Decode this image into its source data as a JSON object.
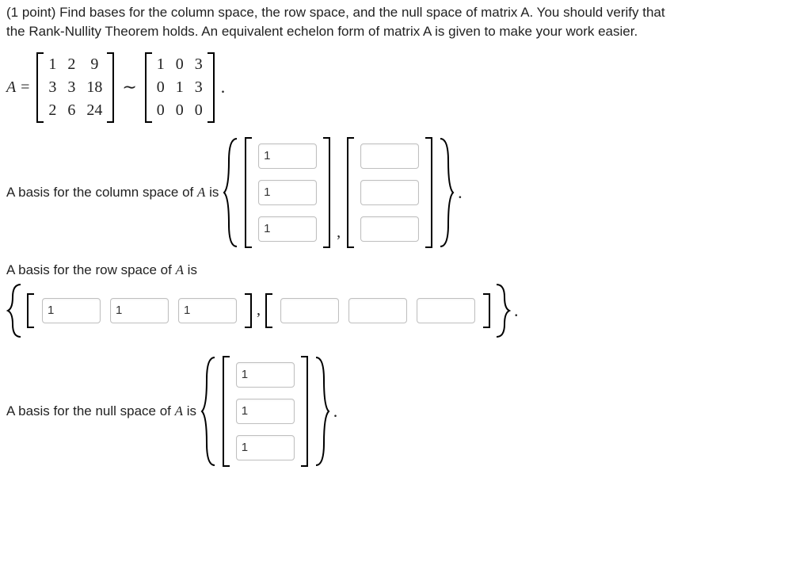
{
  "problem": {
    "points_prefix": "(1 point)",
    "text_line1": "Find bases for the column space, the row space, and the null space of matrix A. You should verify that",
    "text_line2": "the Rank-Nullity Theorem holds. An equivalent echelon form of matrix A is given to make your work easier."
  },
  "matrix_def": {
    "label_lhs": "A =",
    "A": [
      [
        "1",
        "2",
        "9"
      ],
      [
        "3",
        "3",
        "18"
      ],
      [
        "2",
        "6",
        "24"
      ]
    ],
    "tilde": "∼",
    "E": [
      [
        "1",
        "0",
        "3"
      ],
      [
        "0",
        "1",
        "3"
      ],
      [
        "0",
        "0",
        "0"
      ]
    ],
    "trailing_period": "."
  },
  "col_space": {
    "label": "A basis for the column space of ",
    "matrix_letter": "A",
    "label_tail": " is",
    "vec1": [
      "1",
      "1",
      "1"
    ],
    "vec2": [
      "",
      "",
      ""
    ],
    "trailing_period": "."
  },
  "row_space": {
    "label_top": "A basis for the row space of ",
    "matrix_letter": "A",
    "label_tail": " is",
    "row1": [
      "1",
      "1",
      "1"
    ],
    "row2": [
      "",
      "",
      ""
    ],
    "trailing_period": "."
  },
  "null_space": {
    "label": "A basis for the null space of ",
    "matrix_letter": "A",
    "label_tail": " is",
    "vec": [
      "1",
      "1",
      "1"
    ],
    "trailing_period": "."
  }
}
